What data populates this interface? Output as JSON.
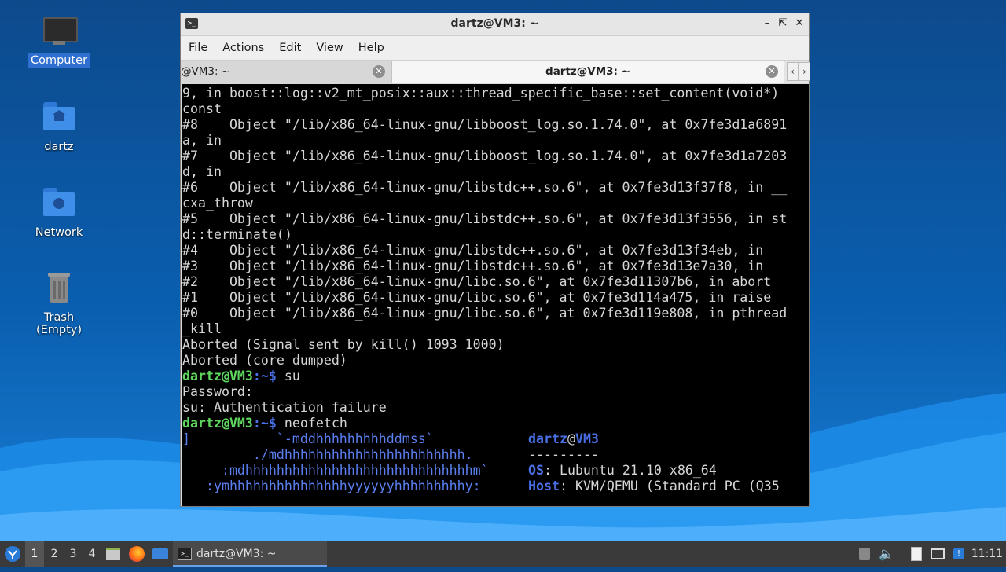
{
  "desktop": {
    "icons": [
      {
        "label": "Computer"
      },
      {
        "label": "dartz"
      },
      {
        "label": "Network"
      },
      {
        "label": "Trash (Empty)"
      }
    ]
  },
  "window": {
    "title": "dartz@VM3: ~",
    "menu": [
      "File",
      "Actions",
      "Edit",
      "View",
      "Help"
    ],
    "tabs": [
      {
        "label": "@VM3: ~"
      },
      {
        "label": "dartz@VM3: ~"
      }
    ]
  },
  "terminal": {
    "lines": [
      "9, in boost::log::v2_mt_posix::aux::thread_specific_base::set_content(void*)",
      "const",
      "#8    Object \"/lib/x86_64-linux-gnu/libboost_log.so.1.74.0\", at 0x7fe3d1a6891",
      "a, in",
      "#7    Object \"/lib/x86_64-linux-gnu/libboost_log.so.1.74.0\", at 0x7fe3d1a7203",
      "d, in",
      "#6    Object \"/lib/x86_64-linux-gnu/libstdc++.so.6\", at 0x7fe3d13f37f8, in __",
      "cxa_throw",
      "#5    Object \"/lib/x86_64-linux-gnu/libstdc++.so.6\", at 0x7fe3d13f3556, in st",
      "d::terminate()",
      "#4    Object \"/lib/x86_64-linux-gnu/libstdc++.so.6\", at 0x7fe3d13f34eb, in",
      "#3    Object \"/lib/x86_64-linux-gnu/libstdc++.so.6\", at 0x7fe3d13e7a30, in",
      "#2    Object \"/lib/x86_64-linux-gnu/libc.so.6\", at 0x7fe3d11307b6, in abort",
      "#1    Object \"/lib/x86_64-linux-gnu/libc.so.6\", at 0x7fe3d114a475, in raise",
      "#0    Object \"/lib/x86_64-linux-gnu/libc.so.6\", at 0x7fe3d119e808, in pthread",
      "_kill",
      "Aborted (Signal sent by kill() 1093 1000)",
      "Aborted (core dumped)"
    ],
    "prompt_user": "dartz@VM3",
    "prompt_path": ":~$ ",
    "cmd1": "su",
    "password_line": "Password:",
    "auth_fail": "su: Authentication failure",
    "cmd2": "neofetch",
    "neofetch_art": [
      "]           `-mddhhhhhhhhhddmss`",
      "         ./mdhhhhhhhhhhhhhhhhhhhhhhh.",
      "     :mdhhhhhhhhhhhhhhhhhhhhhhhhhhhhhm`",
      "   :ymhhhhhhhhhhhhhhhyyyyyyhhhhhhhhhy:"
    ],
    "nf_user": "dartz",
    "nf_at": "@",
    "nf_host": "VM3",
    "nf_sep": "---------",
    "nf_os_key": "OS",
    "nf_os_val": ": Lubuntu 21.10 x86_64",
    "nf_host_key": "Host",
    "nf_host_val": ": KVM/QEMU (Standard PC (Q35"
  },
  "taskbar": {
    "workspaces": [
      "1",
      "2",
      "3",
      "4"
    ],
    "active_task": "dartz@VM3: ~",
    "clock": "11:11"
  },
  "colors": {
    "prompt_green": "#5fd75f",
    "neofetch_blue": "#4a70e8"
  }
}
